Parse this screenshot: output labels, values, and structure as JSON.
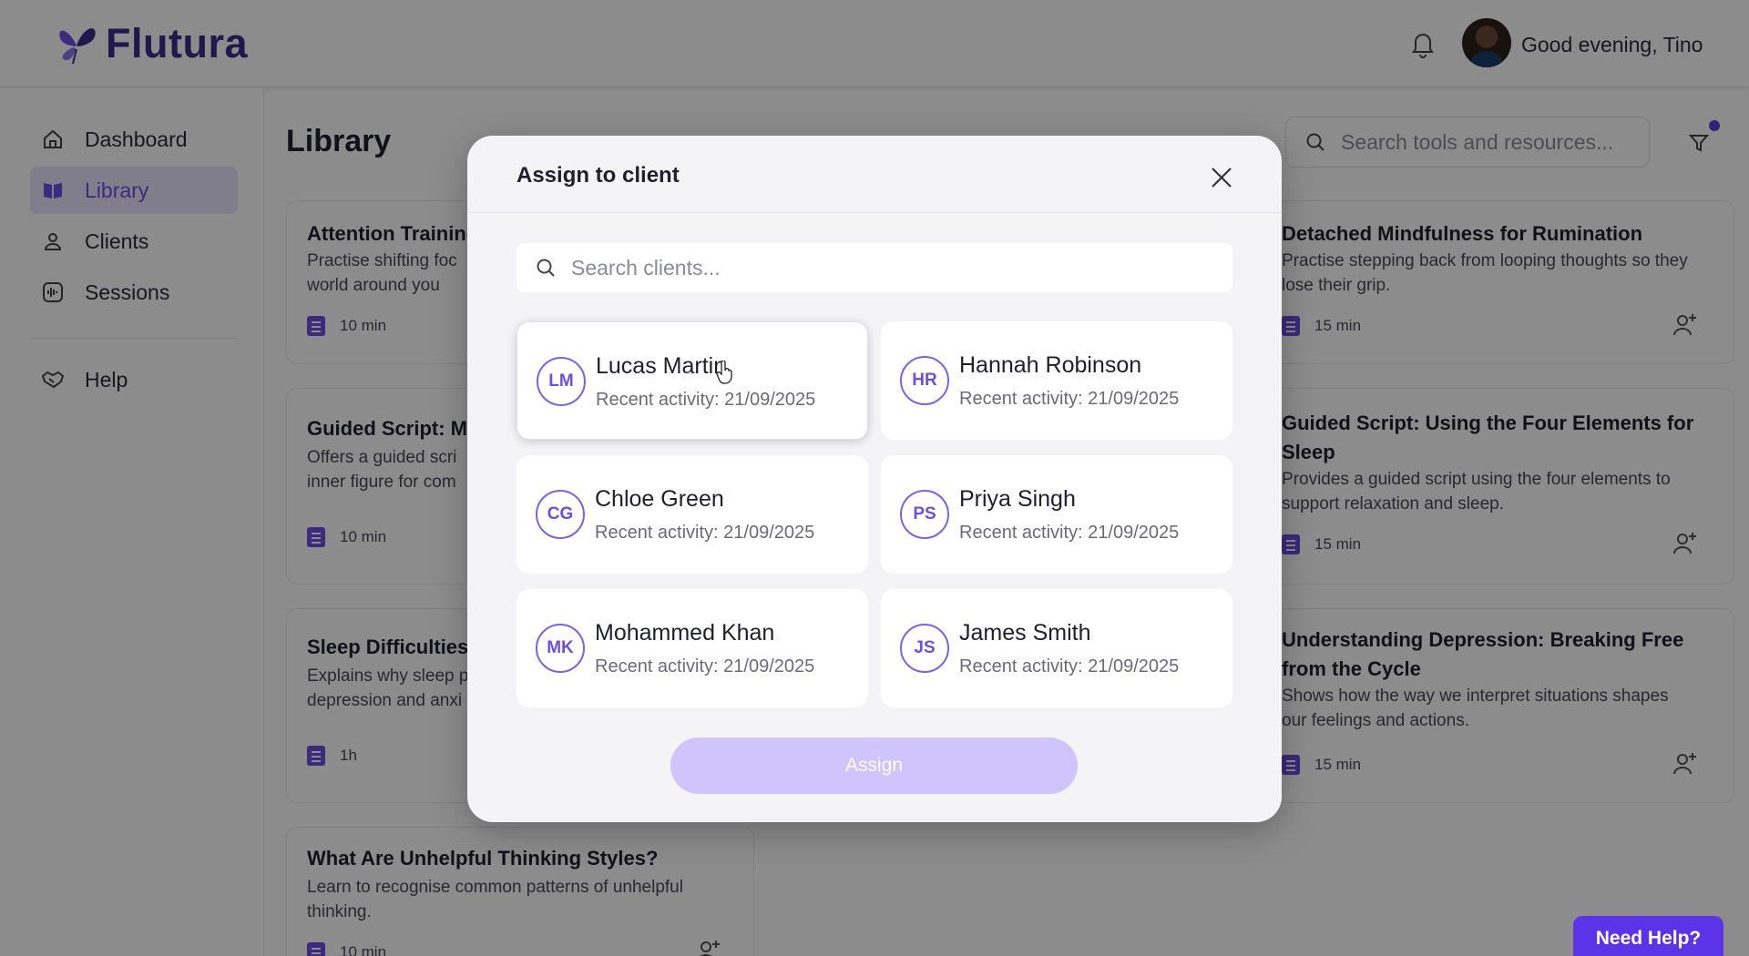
{
  "app": {
    "name": "Flutura"
  },
  "header": {
    "greeting": "Good evening, Tino"
  },
  "sidebar": {
    "items": [
      {
        "label": "Dashboard",
        "icon": "home-icon",
        "active": false
      },
      {
        "label": "Library",
        "icon": "book-icon",
        "active": true
      },
      {
        "label": "Clients",
        "icon": "user-icon",
        "active": false
      },
      {
        "label": "Sessions",
        "icon": "audio-wave-icon",
        "active": false
      },
      {
        "label": "Help",
        "icon": "handshake-icon",
        "active": false
      }
    ]
  },
  "main": {
    "title": "Library",
    "search_placeholder": "Search tools and resources...",
    "cards": [
      {
        "title": "Attention Training",
        "desc": [
          "Practise shifting foc",
          "world around you"
        ],
        "duration": "10 min"
      },
      {
        "title": "Guided Script: Me",
        "desc": [
          "Offers a guided scri",
          "inner figure for com"
        ],
        "duration": "10 min"
      },
      {
        "title": "Sleep Difficulties",
        "desc": [
          "Explains why sleep p",
          "depression and anxi"
        ],
        "duration": "1h"
      },
      {
        "title": "What Are Unhelpful Thinking Styles?",
        "desc": [
          "Learn to recognise common patterns of unhelpful",
          "thinking."
        ],
        "duration": "10 min"
      },
      {
        "title": "Detached Mindfulness for Rumination",
        "desc": [
          "Practise stepping back from looping thoughts so they",
          "lose their grip."
        ],
        "duration": "15 min"
      },
      {
        "title": "Guided Script: Using the Four Elements for Sleep",
        "desc": [
          "Provides a guided script using the four elements to",
          "support relaxation and sleep."
        ],
        "duration": "15 min"
      },
      {
        "title": "Understanding Depression: Breaking Free from the Cycle",
        "desc": [
          "Shows how the way we interpret situations shapes",
          "our feelings and actions."
        ],
        "duration": "15 min"
      }
    ]
  },
  "modal": {
    "title": "Assign to client",
    "search_placeholder": "Search clients...",
    "clients": [
      {
        "initials": "LM",
        "name": "Lucas Martin",
        "activity": "Recent activity: 21/09/2025"
      },
      {
        "initials": "HR",
        "name": "Hannah Robinson",
        "activity": "Recent activity: 21/09/2025"
      },
      {
        "initials": "CG",
        "name": "Chloe Green",
        "activity": "Recent activity: 21/09/2025"
      },
      {
        "initials": "PS",
        "name": "Priya Singh",
        "activity": "Recent activity: 21/09/2025"
      },
      {
        "initials": "MK",
        "name": "Mohammed Khan",
        "activity": "Recent activity: 21/09/2025"
      },
      {
        "initials": "JS",
        "name": "James Smith",
        "activity": "Recent activity: 21/09/2025"
      }
    ],
    "assign_label": "Assign"
  },
  "help_button": {
    "label": "Need Help?"
  },
  "colors": {
    "accent": "#6c4ee3",
    "brand": "#3d2f8f",
    "assign_disabled": "#cfc4fb",
    "help": "#5b34e8"
  }
}
